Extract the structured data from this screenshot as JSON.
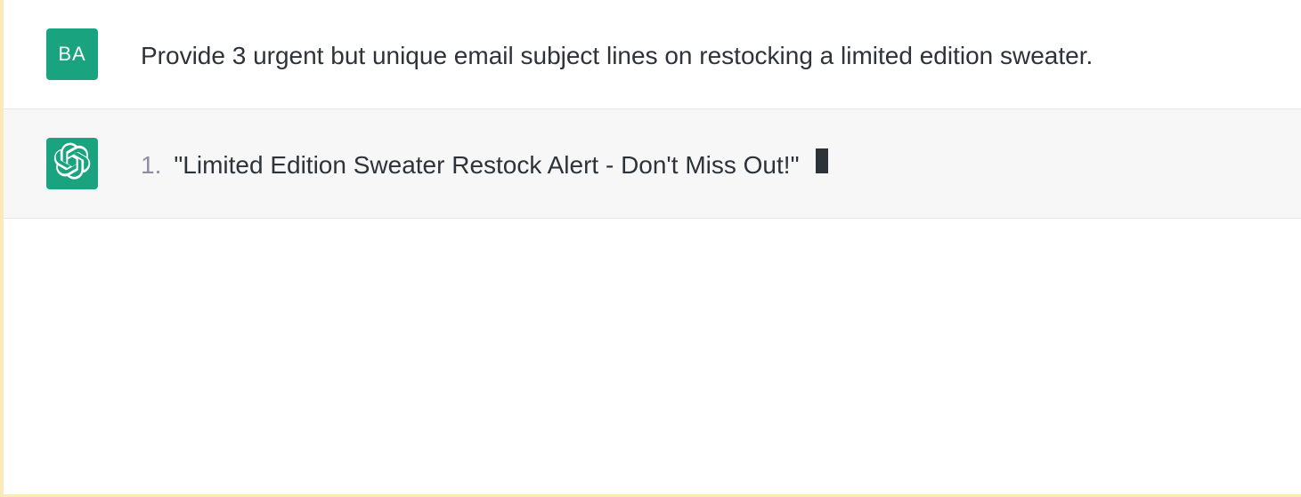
{
  "user": {
    "avatar_initials": "BA",
    "message": "Provide 3 urgent but unique email subject lines on restocking a limited edition sweater."
  },
  "assistant": {
    "list_items": [
      {
        "number": "1.",
        "text": "\"Limited Edition Sweater Restock Alert - Don't Miss Out!\""
      }
    ],
    "typing": true
  }
}
